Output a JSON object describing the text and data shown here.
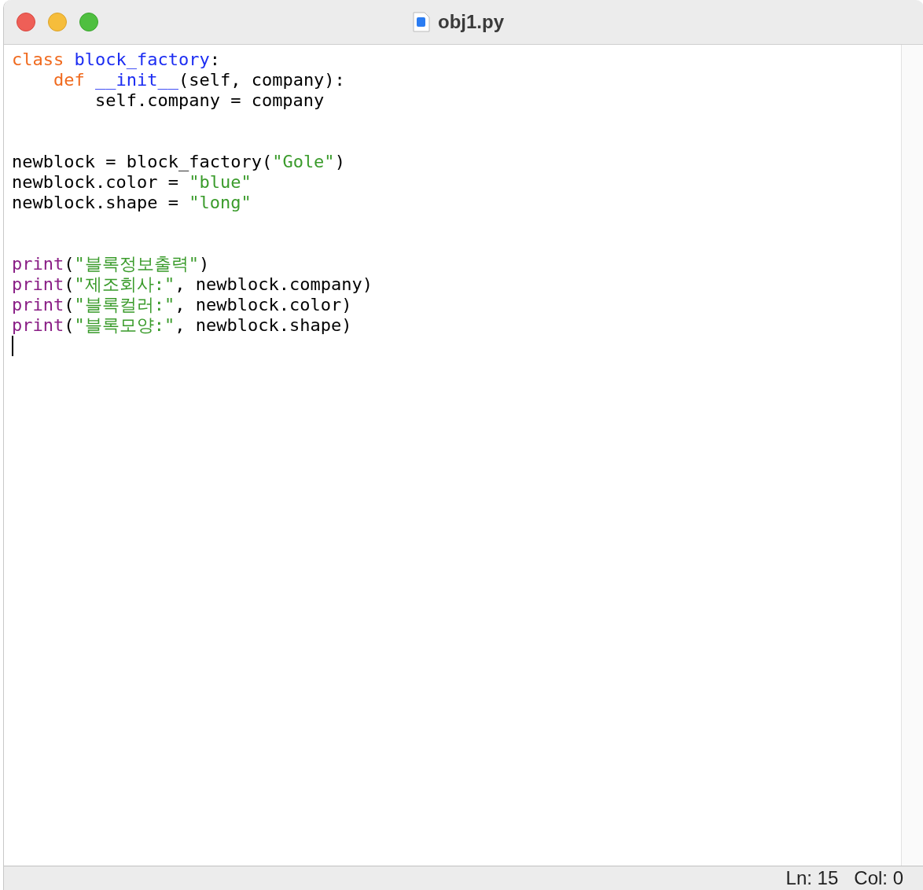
{
  "window": {
    "title": "obj1.py"
  },
  "editor": {
    "lines": [
      {
        "tokens": [
          {
            "kind": "keyword",
            "text": "class "
          },
          {
            "kind": "name",
            "text": "block_factory"
          },
          {
            "kind": "plain",
            "text": ":"
          }
        ]
      },
      {
        "tokens": [
          {
            "kind": "keyword",
            "text": "    def "
          },
          {
            "kind": "name",
            "text": "__init__"
          },
          {
            "kind": "plain",
            "text": "(self, company):"
          }
        ]
      },
      {
        "tokens": [
          {
            "kind": "plain",
            "text": "        self.company = company"
          }
        ]
      },
      {
        "kind": "blank"
      },
      {
        "kind": "blank"
      },
      {
        "tokens": [
          {
            "kind": "plain",
            "text": "newblock = block_factory("
          },
          {
            "kind": "string",
            "text": "\"Gole\""
          },
          {
            "kind": "plain",
            "text": ")"
          }
        ]
      },
      {
        "tokens": [
          {
            "kind": "plain",
            "text": "newblock.color = "
          },
          {
            "kind": "string",
            "text": "\"blue\""
          }
        ]
      },
      {
        "tokens": [
          {
            "kind": "plain",
            "text": "newblock.shape = "
          },
          {
            "kind": "string",
            "text": "\"long\""
          }
        ]
      },
      {
        "kind": "blank"
      },
      {
        "kind": "blank"
      },
      {
        "tokens": [
          {
            "kind": "builtin",
            "text": "print"
          },
          {
            "kind": "plain",
            "text": "("
          },
          {
            "kind": "string",
            "text": "\"블록정보출력\""
          },
          {
            "kind": "plain",
            "text": ")"
          }
        ]
      },
      {
        "tokens": [
          {
            "kind": "builtin",
            "text": "print"
          },
          {
            "kind": "plain",
            "text": "("
          },
          {
            "kind": "string",
            "text": "\"제조회사:\""
          },
          {
            "kind": "plain",
            "text": ", newblock.company)"
          }
        ]
      },
      {
        "tokens": [
          {
            "kind": "builtin",
            "text": "print"
          },
          {
            "kind": "plain",
            "text": "("
          },
          {
            "kind": "string",
            "text": "\"블록컬러:\""
          },
          {
            "kind": "plain",
            "text": ", newblock.color)"
          }
        ]
      },
      {
        "tokens": [
          {
            "kind": "builtin",
            "text": "print"
          },
          {
            "kind": "plain",
            "text": "("
          },
          {
            "kind": "string",
            "text": "\"블록모양:\""
          },
          {
            "kind": "plain",
            "text": ", newblock.shape)"
          }
        ]
      },
      {
        "kind": "cursor"
      }
    ]
  },
  "status_bar": {
    "line": "Ln: 15",
    "column": "Col: 0"
  }
}
